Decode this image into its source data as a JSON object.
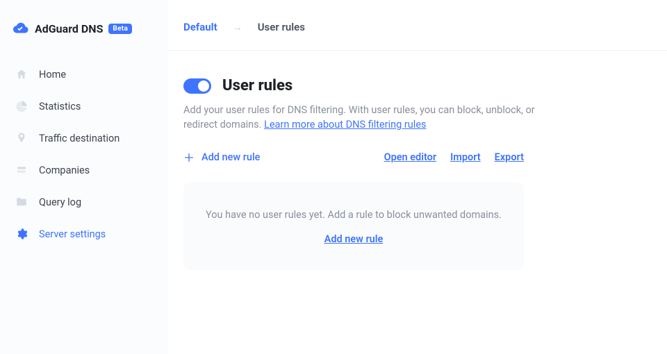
{
  "brand": {
    "name": "AdGuard DNS",
    "badge": "Beta"
  },
  "sidebar": {
    "items": [
      {
        "label": "Home",
        "icon": "home-icon",
        "active": false
      },
      {
        "label": "Statistics",
        "icon": "pie-icon",
        "active": false
      },
      {
        "label": "Traffic destination",
        "icon": "pin-icon",
        "active": false
      },
      {
        "label": "Companies",
        "icon": "stack-icon",
        "active": false
      },
      {
        "label": "Query log",
        "icon": "folder-icon",
        "active": false
      },
      {
        "label": "Server settings",
        "icon": "gear-icon",
        "active": true
      }
    ]
  },
  "breadcrumbs": {
    "root": "Default",
    "current": "User rules"
  },
  "page": {
    "title": "User rules",
    "toggle_on": true,
    "description_pre": "Add your user rules for DNS filtering. With user rules, you can block, unblock, or redirect domains. ",
    "learn_more": "Learn more about DNS filtering rules"
  },
  "actions": {
    "add_new_rule": "Add new rule",
    "open_editor": "Open editor",
    "import": "Import",
    "export": "Export"
  },
  "empty_state": {
    "text": "You have no user rules yet. Add a rule to block unwanted domains.",
    "link": "Add new rule"
  }
}
